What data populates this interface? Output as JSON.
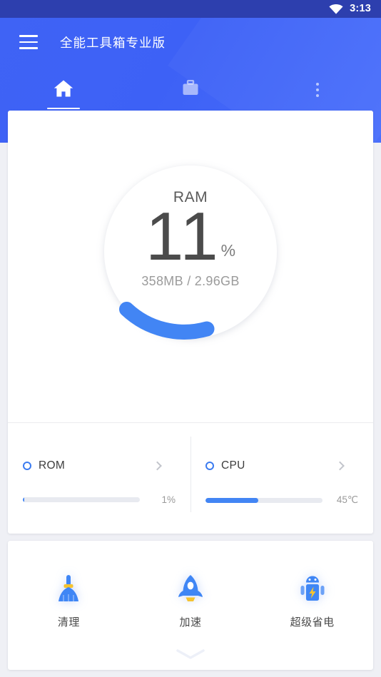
{
  "status_bar": {
    "time": "3:13",
    "wifi_icon": "wifi-icon"
  },
  "header": {
    "menu_icon": "hamburger-menu-icon",
    "title": "全能工具箱专业版",
    "background_color": "#3f63f5",
    "tabs": [
      {
        "icon": "home-icon",
        "name": "home",
        "active": true
      },
      {
        "icon": "briefcase-icon",
        "name": "toolbox",
        "active": false
      },
      {
        "icon": "overflow-menu-icon",
        "name": "more",
        "active": false
      }
    ]
  },
  "ram_gauge": {
    "label": "RAM",
    "value": "11",
    "unit": "%",
    "detail": "358MB / 2.96GB",
    "used_mb": 358,
    "total_gb": 2.96,
    "percent": 11,
    "arc_color": "#4285f4",
    "track_color": "#ffffff"
  },
  "stats": [
    {
      "name": "ROM",
      "icon": "ring-indicator-icon",
      "chevron": "chevron-right-icon",
      "value_text": "1%",
      "percent": 1,
      "accent": "#4285f4"
    },
    {
      "name": "CPU",
      "icon": "ring-indicator-icon",
      "chevron": "chevron-right-icon",
      "value_text": "45℃",
      "percent": 45,
      "accent": "#4285f4"
    }
  ],
  "actions": [
    {
      "label": "清理",
      "icon": "broom-icon"
    },
    {
      "label": "加速",
      "icon": "rocket-icon"
    },
    {
      "label": "超级省电",
      "icon": "android-battery-icon"
    }
  ],
  "expand_indicator": "chevron-down-icon"
}
